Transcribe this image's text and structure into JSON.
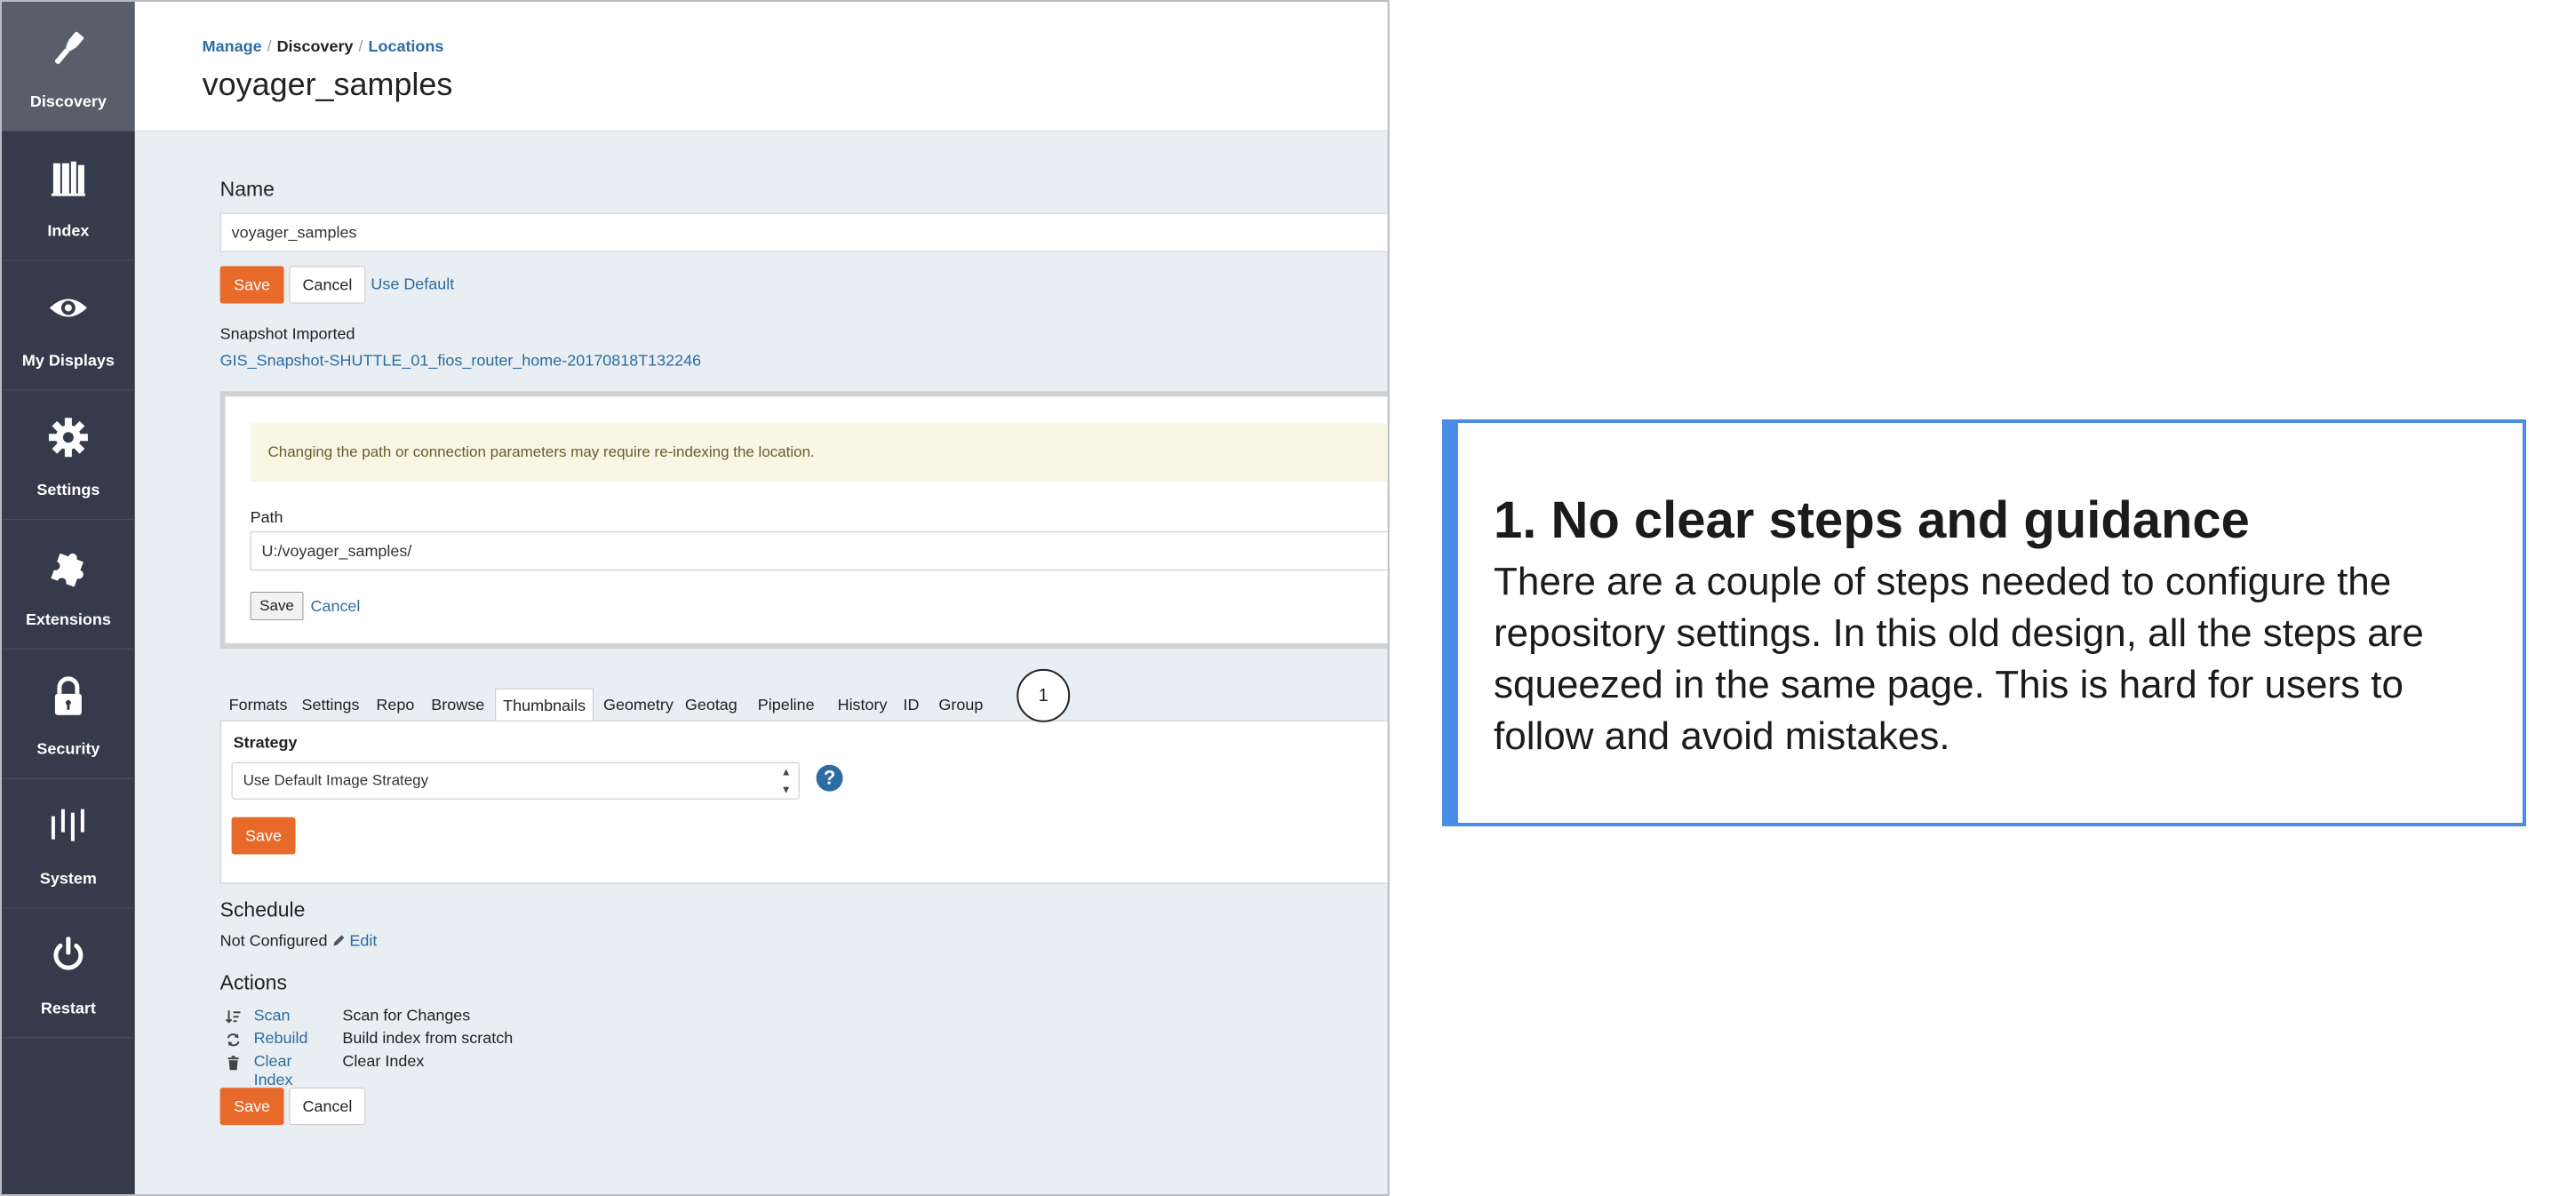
{
  "sidebar": {
    "items": [
      {
        "label": "Discovery",
        "icon": "flashlight-icon",
        "active": true
      },
      {
        "label": "Index",
        "icon": "books-icon"
      },
      {
        "label": "My Displays",
        "icon": "eye-icon"
      },
      {
        "label": "Settings",
        "icon": "gear-icon"
      },
      {
        "label": "Extensions",
        "icon": "puzzle-icon"
      },
      {
        "label": "Security",
        "icon": "lock-icon"
      },
      {
        "label": "System",
        "icon": "equalizer-icon"
      },
      {
        "label": "Restart",
        "icon": "power-icon"
      }
    ]
  },
  "header": {
    "breadcrumb": [
      "Manage",
      "Discovery",
      "Locations"
    ],
    "title": "voyager_samples"
  },
  "name_section": {
    "label": "Name",
    "value": "voyager_samples",
    "save": "Save",
    "cancel": "Cancel",
    "use_default": "Use Default"
  },
  "snapshot": {
    "label": "Snapshot Imported",
    "link": "GIS_Snapshot-SHUTTLE_01_fios_router_home-20170818T132246"
  },
  "path_section": {
    "warning": "Changing the path or connection parameters may require re-indexing the location.",
    "label": "Path",
    "value": "U:/voyager_samples/",
    "save": "Save",
    "cancel": "Cancel"
  },
  "tabs": [
    "Formats",
    "Settings",
    "Repo",
    "Browse",
    "Thumbnails",
    "Geometry",
    "Geotag",
    "Pipeline",
    "History",
    "ID",
    "Group"
  ],
  "active_tab": "Thumbnails",
  "strategy": {
    "label": "Strategy",
    "selected": "Use Default Image Strategy",
    "save": "Save"
  },
  "step_marker": "1",
  "schedule": {
    "label": "Schedule",
    "status": "Not Configured",
    "edit": "Edit"
  },
  "actions": {
    "label": "Actions",
    "items": [
      {
        "name": "Scan",
        "desc": "Scan for Changes",
        "icon": "sort-icon"
      },
      {
        "name": "Rebuild",
        "desc": "Build index from scratch",
        "icon": "refresh-icon"
      },
      {
        "name": "Clear Index",
        "desc": "Clear Index",
        "icon": "trash-icon"
      }
    ],
    "save": "Save",
    "cancel": "Cancel"
  },
  "callout": {
    "title": "1. No clear steps and guidance",
    "body": "There are a couple of steps needed to configure the repository settings. In this old design, all the steps are squeezed in the same page. This is hard for users to follow and avoid mistakes."
  },
  "colors": {
    "sidebar": "#363b4b",
    "accent_orange": "#e86a2b",
    "link": "#2d6ca3",
    "callout_border": "#4a8de6"
  }
}
